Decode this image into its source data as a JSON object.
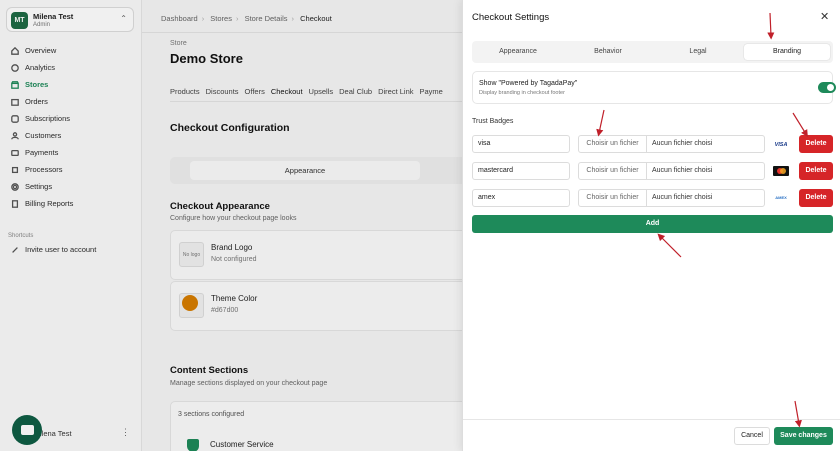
{
  "sidebar": {
    "workspace": {
      "initials": "MT",
      "name": "Milena Test",
      "role": "Admin"
    },
    "items": [
      {
        "label": "Overview",
        "icon": "home-icon"
      },
      {
        "label": "Analytics",
        "icon": "chart-icon"
      },
      {
        "label": "Stores",
        "icon": "store-icon",
        "active": true
      },
      {
        "label": "Orders",
        "icon": "box-icon"
      },
      {
        "label": "Subscriptions",
        "icon": "refresh-icon"
      },
      {
        "label": "Customers",
        "icon": "users-icon"
      },
      {
        "label": "Payments",
        "icon": "card-icon"
      },
      {
        "label": "Processors",
        "icon": "processor-icon"
      },
      {
        "label": "Settings",
        "icon": "gear-icon"
      },
      {
        "label": "Billing Reports",
        "icon": "report-icon"
      }
    ],
    "shortcuts_heading": "Shortcuts",
    "shortcut_invite": "Invite user to account",
    "user_name": "ilena Test",
    "user_menu": "⋮"
  },
  "main": {
    "breadcrumb": [
      "Dashboard",
      "Stores",
      "Store Details",
      "Checkout"
    ],
    "store_label": "Store",
    "store_name": "Demo Store",
    "tabs": [
      "Products",
      "Discounts",
      "Offers",
      "Checkout",
      "Upsells",
      "Deal Club",
      "Direct Link",
      "Payme"
    ],
    "active_tab": "Checkout",
    "config_heading": "Checkout Configuration",
    "config_tab": "Appearance",
    "appearance_heading": "Checkout Appearance",
    "appearance_desc": "Configure how your checkout page looks",
    "brand_logo": {
      "title": "Brand Logo",
      "status": "Not configured",
      "placeholder": "No logo"
    },
    "theme_color": {
      "title": "Theme Color",
      "value": "#d67d00"
    },
    "content_heading": "Content Sections",
    "content_desc": "Manage sections displayed on your checkout page",
    "sections_count": "3 sections configured",
    "first_section": "Customer Service"
  },
  "panel": {
    "title": "Checkout Settings",
    "close": "✕",
    "tabs": [
      "Appearance",
      "Behavior",
      "Legal",
      "Branding"
    ],
    "active_tab": "Branding",
    "powered_title": "Show \"Powered by TagadaPay\"",
    "powered_desc": "Display branding in checkout footer",
    "powered_enabled": true,
    "trust_heading": "Trust Badges",
    "badges": [
      {
        "name": "visa",
        "icon": "visa-icon",
        "icon_text": "VISA"
      },
      {
        "name": "mastercard",
        "icon": "mastercard-icon",
        "icon_text": ""
      },
      {
        "name": "amex",
        "icon": "amex-icon",
        "icon_text": "AMEX"
      }
    ],
    "file_button": "Choisir un fichier",
    "file_none": "Aucun fichier choisi",
    "delete_label": "Delete",
    "add_label": "Add",
    "cancel_label": "Cancel",
    "save_label": "Save changes"
  },
  "colors": {
    "accent": "#1e8a5a",
    "danger": "#d62528",
    "annotation": "#c0202a"
  }
}
